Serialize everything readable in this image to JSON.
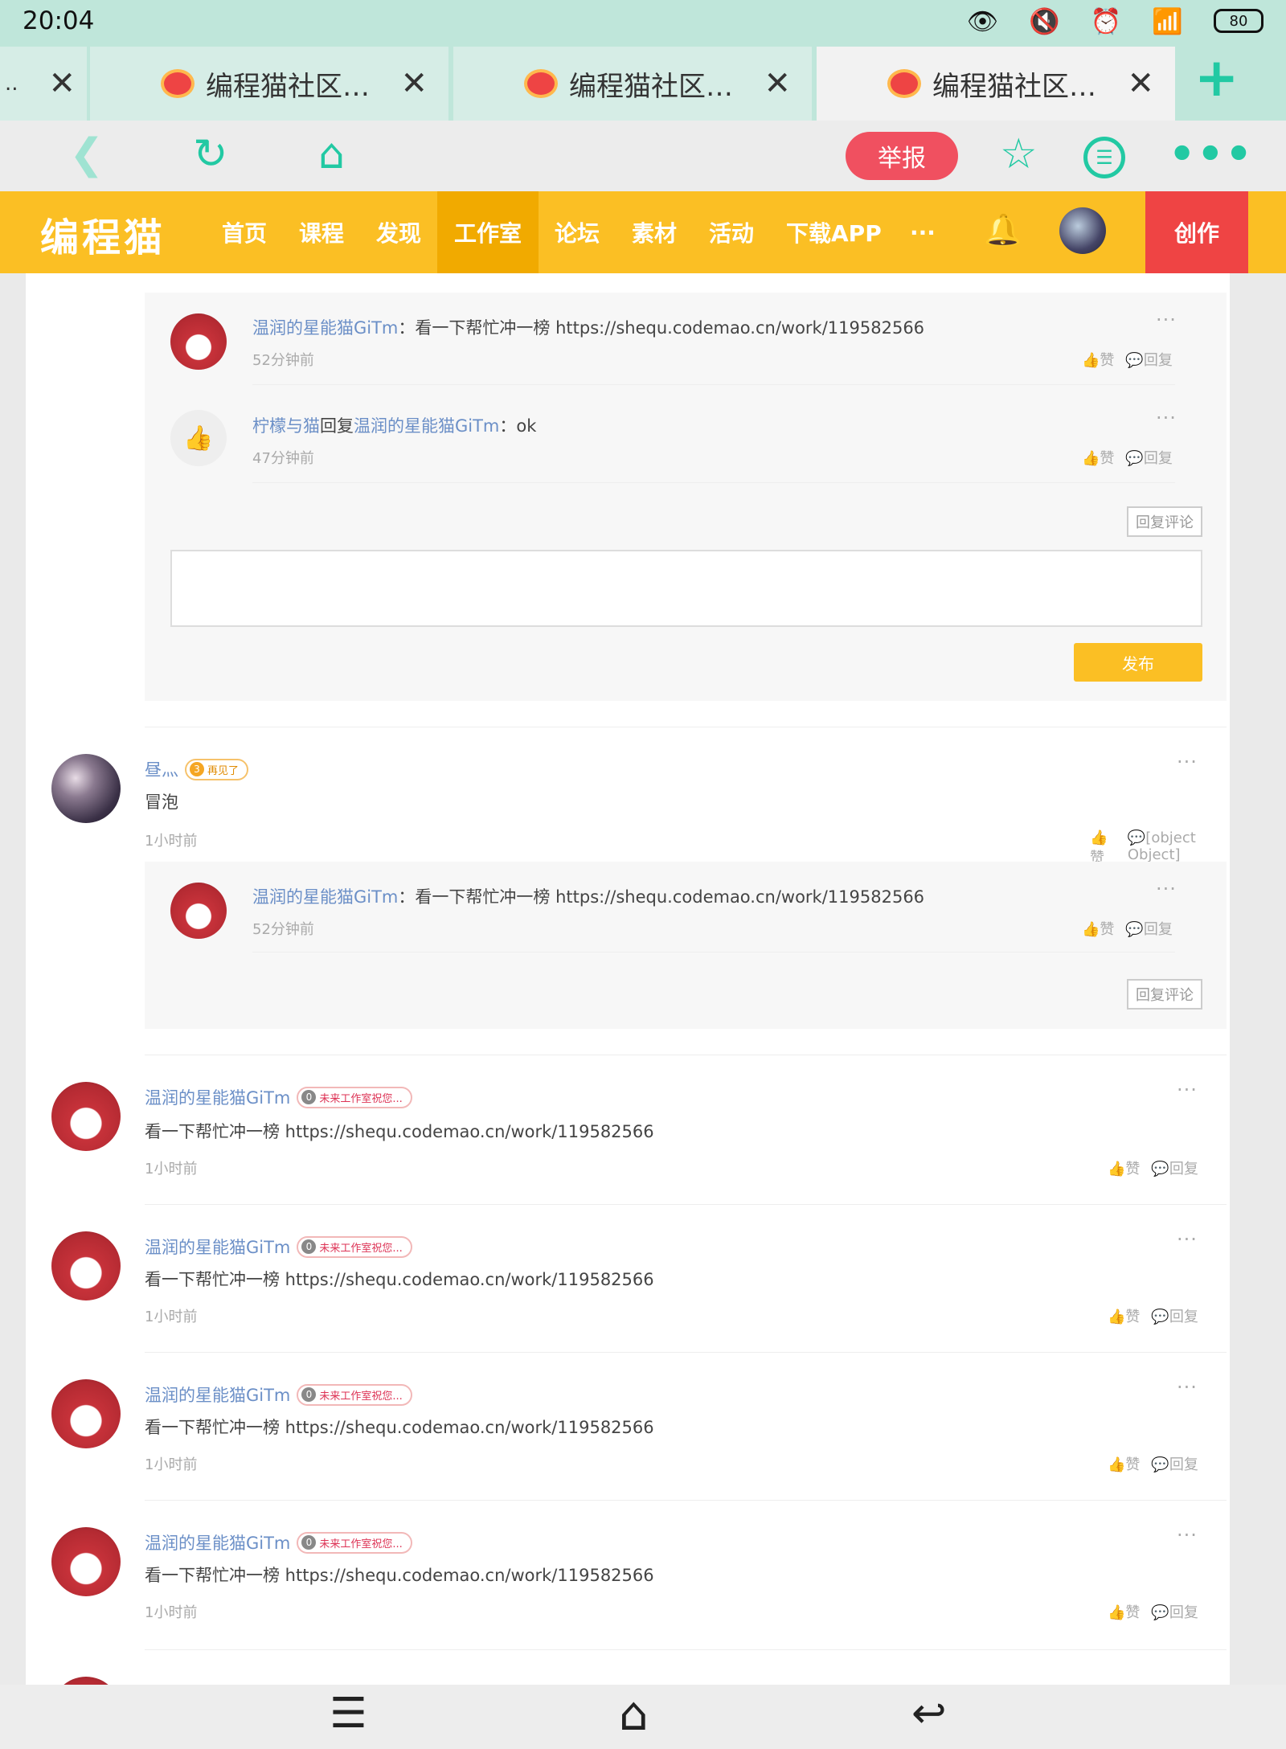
{
  "status": {
    "time": "20:04",
    "battery": "80"
  },
  "tabs": [
    {
      "label": "编程猫社区…",
      "close": "✕"
    },
    {
      "label": "编程猫社区…",
      "close": "✕"
    },
    {
      "label": "编程猫社区…",
      "close": "✕"
    }
  ],
  "tabbar": {
    "partial_close": "✕",
    "new_tab": "+"
  },
  "toolbar": {
    "report": "举报"
  },
  "sitenav": {
    "logo": "编程猫",
    "items": [
      "首页",
      "课程",
      "发现",
      "工作室",
      "论坛",
      "素材",
      "活动",
      "下载APP",
      "···"
    ],
    "create": "创作"
  },
  "thread1": {
    "replies": [
      {
        "name": "温润的星能猫GiTm",
        "text": "：看一下帮忙冲一榜 https://shequ.codemao.cn/work/119582566",
        "time": "52分钟前",
        "like": "赞",
        "reply": "回复"
      },
      {
        "name": "柠檬与猫",
        "reply_word": "回复",
        "target": "温润的星能猫GiTm",
        "text": "：ok",
        "time": "47分钟前",
        "like": "赞",
        "reply": "回复"
      }
    ],
    "reply_comment_btn": "回复评论",
    "publish_btn": "发布"
  },
  "comment2": {
    "name": "昼灬",
    "badge_num": "3",
    "badge_text": "再见了",
    "text": "冒泡",
    "time": "1小时前",
    "like": "赞",
    "reply": {
      "name": "温润的星能猫GiTm",
      "text": "：看一下帮忙冲一榜 https://shequ.codemao.cn/work/119582566",
      "time": "52分钟前",
      "like": "赞",
      "reply": "回复"
    },
    "reply_comment_btn": "回复评论"
  },
  "comments": [
    {
      "name": "温润的星能猫GiTm",
      "badge_num": "0",
      "badge_text": "未来工作室祝您...",
      "text": "看一下帮忙冲一榜 https://shequ.codemao.cn/work/119582566",
      "time": "1小时前",
      "like": "赞",
      "reply": "回复"
    },
    {
      "name": "温润的星能猫GiTm",
      "badge_num": "0",
      "badge_text": "未来工作室祝您...",
      "text": "看一下帮忙冲一榜 https://shequ.codemao.cn/work/119582566",
      "time": "1小时前",
      "like": "赞",
      "reply": "回复"
    },
    {
      "name": "温润的星能猫GiTm",
      "badge_num": "0",
      "badge_text": "未来工作室祝您...",
      "text": "看一下帮忙冲一榜 https://shequ.codemao.cn/work/119582566",
      "time": "1小时前",
      "like": "赞",
      "reply": "回复"
    },
    {
      "name": "温润的星能猫GiTm",
      "badge_num": "0",
      "badge_text": "未来工作室祝您...",
      "text": "看一下帮忙冲一榜 https://shequ.codemao.cn/work/119582566",
      "time": "1小时前",
      "like": "赞",
      "reply": "回复"
    }
  ],
  "colors": {
    "accent": "#fbbf24",
    "create": "#ef4444",
    "report": "#f05060",
    "browser": "#22c9a3"
  }
}
